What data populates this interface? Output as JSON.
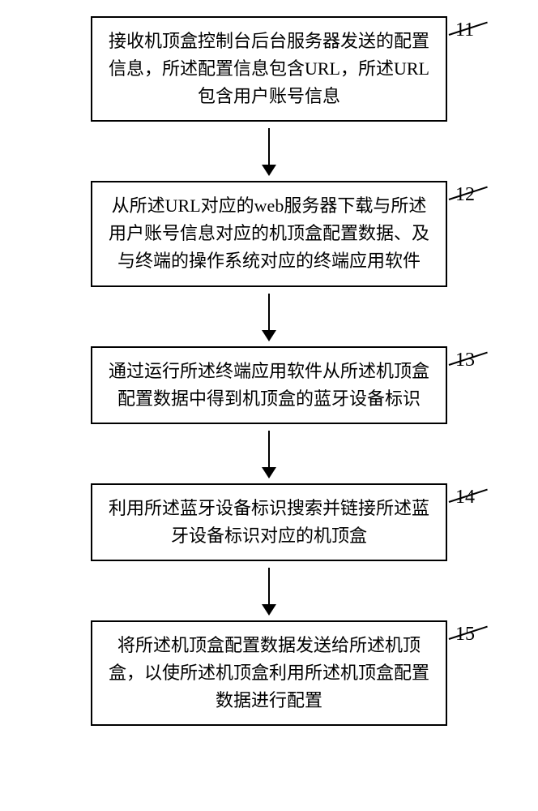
{
  "flowchart": {
    "steps": [
      {
        "num": "11",
        "text": "接收机顶盒控制台后台服务器发送的配置信息，所述配置信息包含URL，所述URL包含用户账号信息"
      },
      {
        "num": "12",
        "text": "从所述URL对应的web服务器下载与所述用户账号信息对应的机顶盒配置数据、及与终端的操作系统对应的终端应用软件"
      },
      {
        "num": "13",
        "text": "通过运行所述终端应用软件从所述机顶盒配置数据中得到机顶盒的蓝牙设备标识"
      },
      {
        "num": "14",
        "text": "利用所述蓝牙设备标识搜索并链接所述蓝牙设备标识对应的机顶盒"
      },
      {
        "num": "15",
        "text": "将所述机顶盒配置数据发送给所述机顶盒，以使所述机顶盒利用所述机顶盒配置数据进行配置"
      }
    ]
  }
}
